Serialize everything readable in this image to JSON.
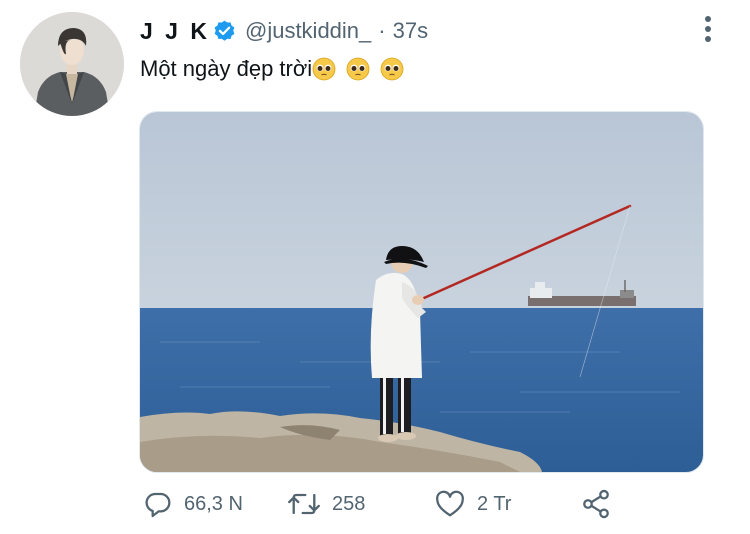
{
  "user": {
    "display_name": "J J K",
    "handle": "@justkiddin_",
    "separator": "·",
    "time": "37s",
    "verified": true,
    "verified_color": "#1d9bf0"
  },
  "tweet": {
    "text": "Một ngày đẹp trời",
    "emojis": [
      "pleading-face-emoji",
      "pleading-face-emoji",
      "pleading-face-emoji"
    ]
  },
  "actions": {
    "reply_count": "66,3 N",
    "retweet_count": "258",
    "like_count": "2 Tr"
  },
  "icons": {
    "more": "more-vertical-icon",
    "reply": "reply-icon",
    "retweet": "retweet-icon",
    "like": "heart-icon",
    "share": "share-icon"
  },
  "colors": {
    "text": "#0f1419",
    "muted": "#536471"
  }
}
